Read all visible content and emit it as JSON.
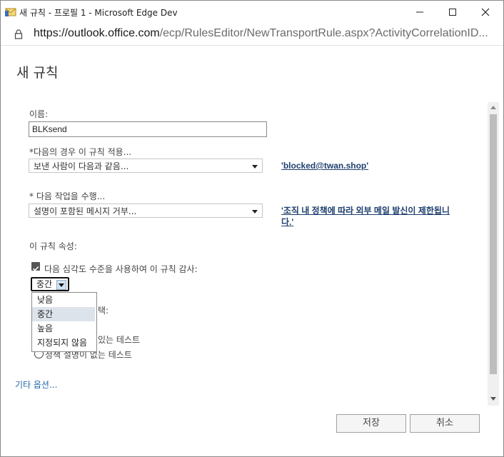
{
  "window": {
    "title": "새 규칙 - 프로필 1 - Microsoft Edge Dev",
    "url_host": "https://outlook.office.com",
    "url_path": "/ecp/RulesEditor/NewTransportRule.aspx?ActivityCorrelationID..."
  },
  "page": {
    "title": "새 규칙"
  },
  "form": {
    "name_label": "이름:",
    "name_value": "BLKsend",
    "condition_label": "*다음의 경우 이 규칙 적용...",
    "condition_value": "보낸 사람이 다음과 같음...",
    "condition_link": "'blocked@twan.shop'",
    "action_label": "* 다음 작업을 수행...",
    "action_value": "설명이 포함된 메시지 거부...",
    "action_link_line1": "'조직 내 정책에 따라 외부 메일 발신이 제한됩니",
    "action_link_line2": "다.'",
    "props_label": "이 규칙 속성:",
    "audit_label": "다음 심각도 수준을 사용하여 이 규칙 감사:",
    "severity_value": "중간",
    "mode_label_visible": "택:",
    "radio1_label_visible": "있는 테스트",
    "radio2_label": "정책 설명이 없는 테스트",
    "more_options": "기타 옵션..."
  },
  "severity_options": [
    "낮음",
    "중간",
    "높음",
    "지정되지 않음"
  ],
  "severity_selected": "중간",
  "buttons": {
    "save": "저장",
    "cancel": "취소"
  },
  "colors": {
    "link": "#1f3f6e",
    "more_options": "#2266aa",
    "selected_option_bg": "#dde3ea"
  }
}
